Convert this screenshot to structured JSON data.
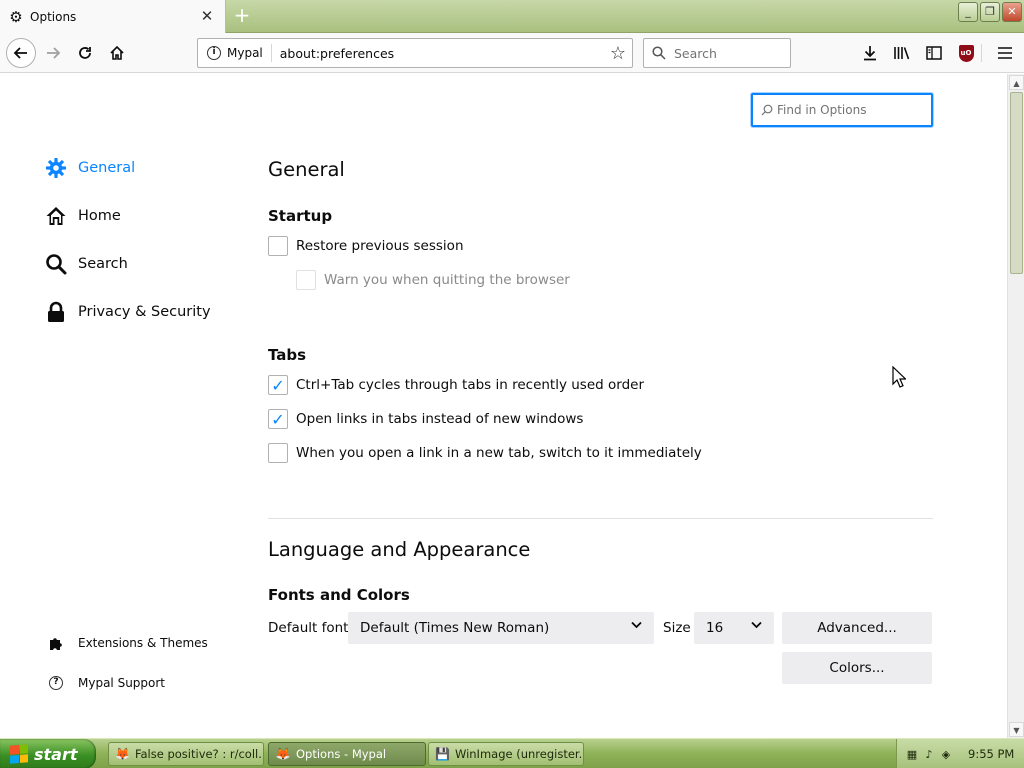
{
  "window": {
    "tab_title": "Options",
    "tab_close": "✕",
    "new_tab": "+",
    "controls": {
      "minimize": "_",
      "restore": "❐",
      "close": "✕"
    }
  },
  "navbar": {
    "identity": "Mypal",
    "url": "about:preferences",
    "search_placeholder": "Search"
  },
  "find": {
    "placeholder": "Find in Options"
  },
  "sidebar": {
    "categories": [
      {
        "label": "General",
        "icon": "gear-icon",
        "selected": true
      },
      {
        "label": "Home",
        "icon": "home-icon"
      },
      {
        "label": "Search",
        "icon": "search-icon"
      },
      {
        "label": "Privacy & Security",
        "icon": "lock-icon"
      }
    ],
    "footer": [
      {
        "label": "Extensions & Themes",
        "icon": "puzzle-icon"
      },
      {
        "label": "Mypal Support",
        "icon": "help-icon"
      }
    ]
  },
  "main": {
    "heading": "General",
    "startup": {
      "heading": "Startup",
      "restore_session": "Restore previous session",
      "restore_session_checked": false,
      "warn_quit": "Warn you when quitting the browser",
      "warn_quit_checked": false,
      "warn_quit_disabled": true
    },
    "tabs": {
      "heading": "Tabs",
      "items": [
        {
          "label": "Ctrl+Tab cycles through tabs in recently used order",
          "checked": true
        },
        {
          "label": "Open links in tabs instead of new windows",
          "checked": true
        },
        {
          "label": "When you open a link in a new tab, switch to it immediately",
          "checked": false
        }
      ]
    },
    "language": {
      "heading": "Language and Appearance",
      "fonts_heading": "Fonts and Colors",
      "default_font_label": "Default font",
      "default_font_value": "Default (Times New Roman)",
      "size_label": "Size",
      "size_value": "16",
      "advanced_button": "Advanced...",
      "colors_button": "Colors..."
    }
  },
  "taskbar": {
    "start_label": "start",
    "tasks": [
      {
        "label": "False positive? : r/coll...",
        "active": false
      },
      {
        "label": "Options - Mypal",
        "active": true
      },
      {
        "label": "WinImage (unregister...",
        "active": false
      }
    ],
    "clock": "9:55 PM"
  },
  "colors": {
    "accent": "#0a84ff",
    "xp_green": "#3a8f23",
    "ublock_red": "#8f0d16"
  }
}
